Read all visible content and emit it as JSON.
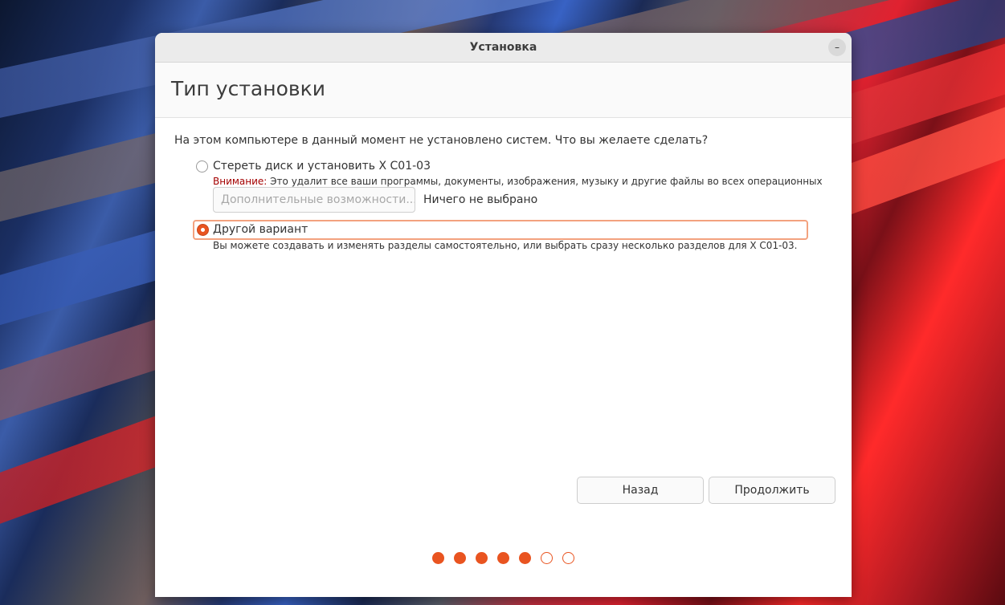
{
  "window": {
    "title": "Установка",
    "minimize_glyph": "–"
  },
  "page": {
    "title": "Тип установки",
    "question": "На этом компьютере в данный момент не установлено систем. Что вы желаете сделать?"
  },
  "options": [
    {
      "label": "Стереть диск и установить X C01-03",
      "warning_word": "Внимание:",
      "note": " Это удалит все ваши программы, документы, изображения, музыку и другие файлы во всех операционных системах.",
      "selected": false
    },
    {
      "label": "Другой вариант",
      "note": "Вы можете создавать и изменять разделы самостоятельно, или выбрать сразу несколько разделов для X C01-03.",
      "selected": true
    }
  ],
  "advanced": {
    "button_label": "Дополнительные возможности...",
    "status": "Ничего не выбрано"
  },
  "buttons": {
    "back": "Назад",
    "continue": "Продолжить"
  },
  "progress": {
    "total_steps": 7,
    "completed_steps": 5
  },
  "colors": {
    "accent": "#e95420",
    "warning": "#a40000"
  }
}
